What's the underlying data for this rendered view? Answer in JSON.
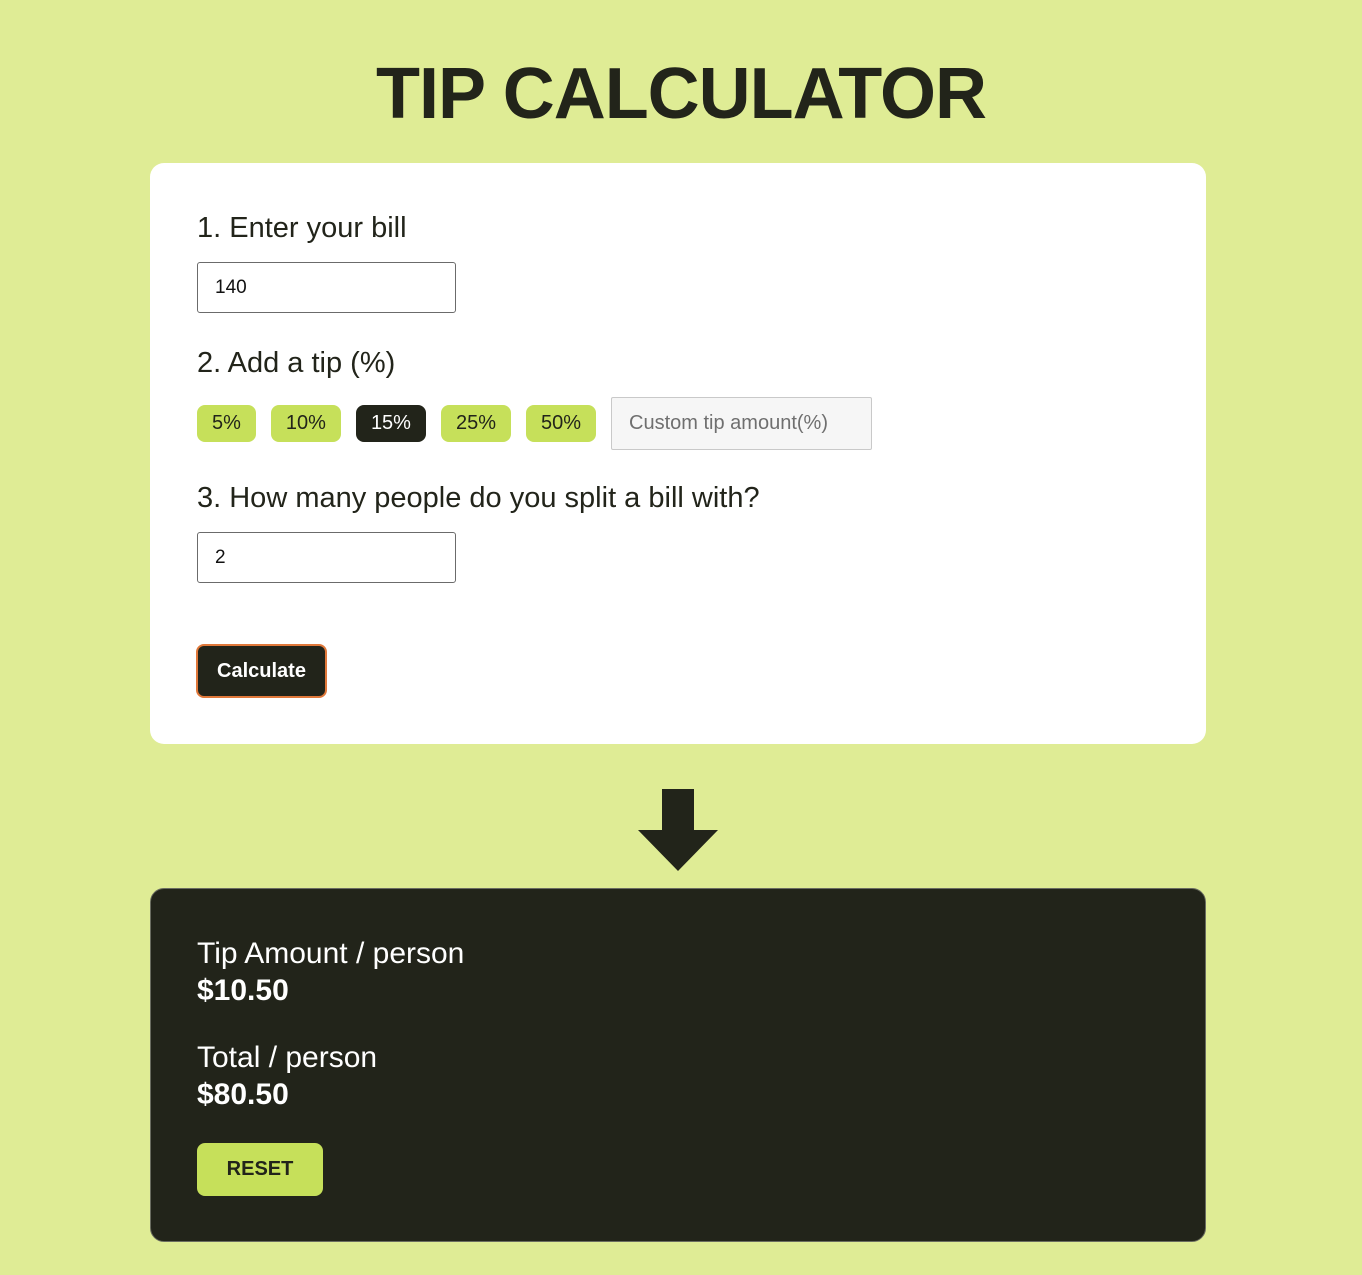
{
  "app": {
    "title": "TIP CALCULATOR"
  },
  "form": {
    "bill_label": "1. Enter your bill",
    "bill_value": "140",
    "tip_label": "2. Add a tip (%)",
    "tip_options": [
      "5%",
      "10%",
      "15%",
      "25%",
      "50%"
    ],
    "selected_tip": "15%",
    "custom_tip_placeholder": "Custom tip amount(%)",
    "people_label": "3. How many people do you split a bill with?",
    "people_value": "2",
    "calculate_label": "Calculate"
  },
  "results": {
    "tip_label": "Tip Amount / person",
    "tip_value": "$10.50",
    "total_label": "Total / person",
    "total_value": "$80.50",
    "reset_label": "RESET"
  },
  "colors": {
    "background": "#dfec95",
    "accent": "#c6e05a",
    "dark": "#22241a",
    "calculate_border": "#e0783a"
  },
  "icons": {
    "arrow": "arrow-down-icon"
  }
}
